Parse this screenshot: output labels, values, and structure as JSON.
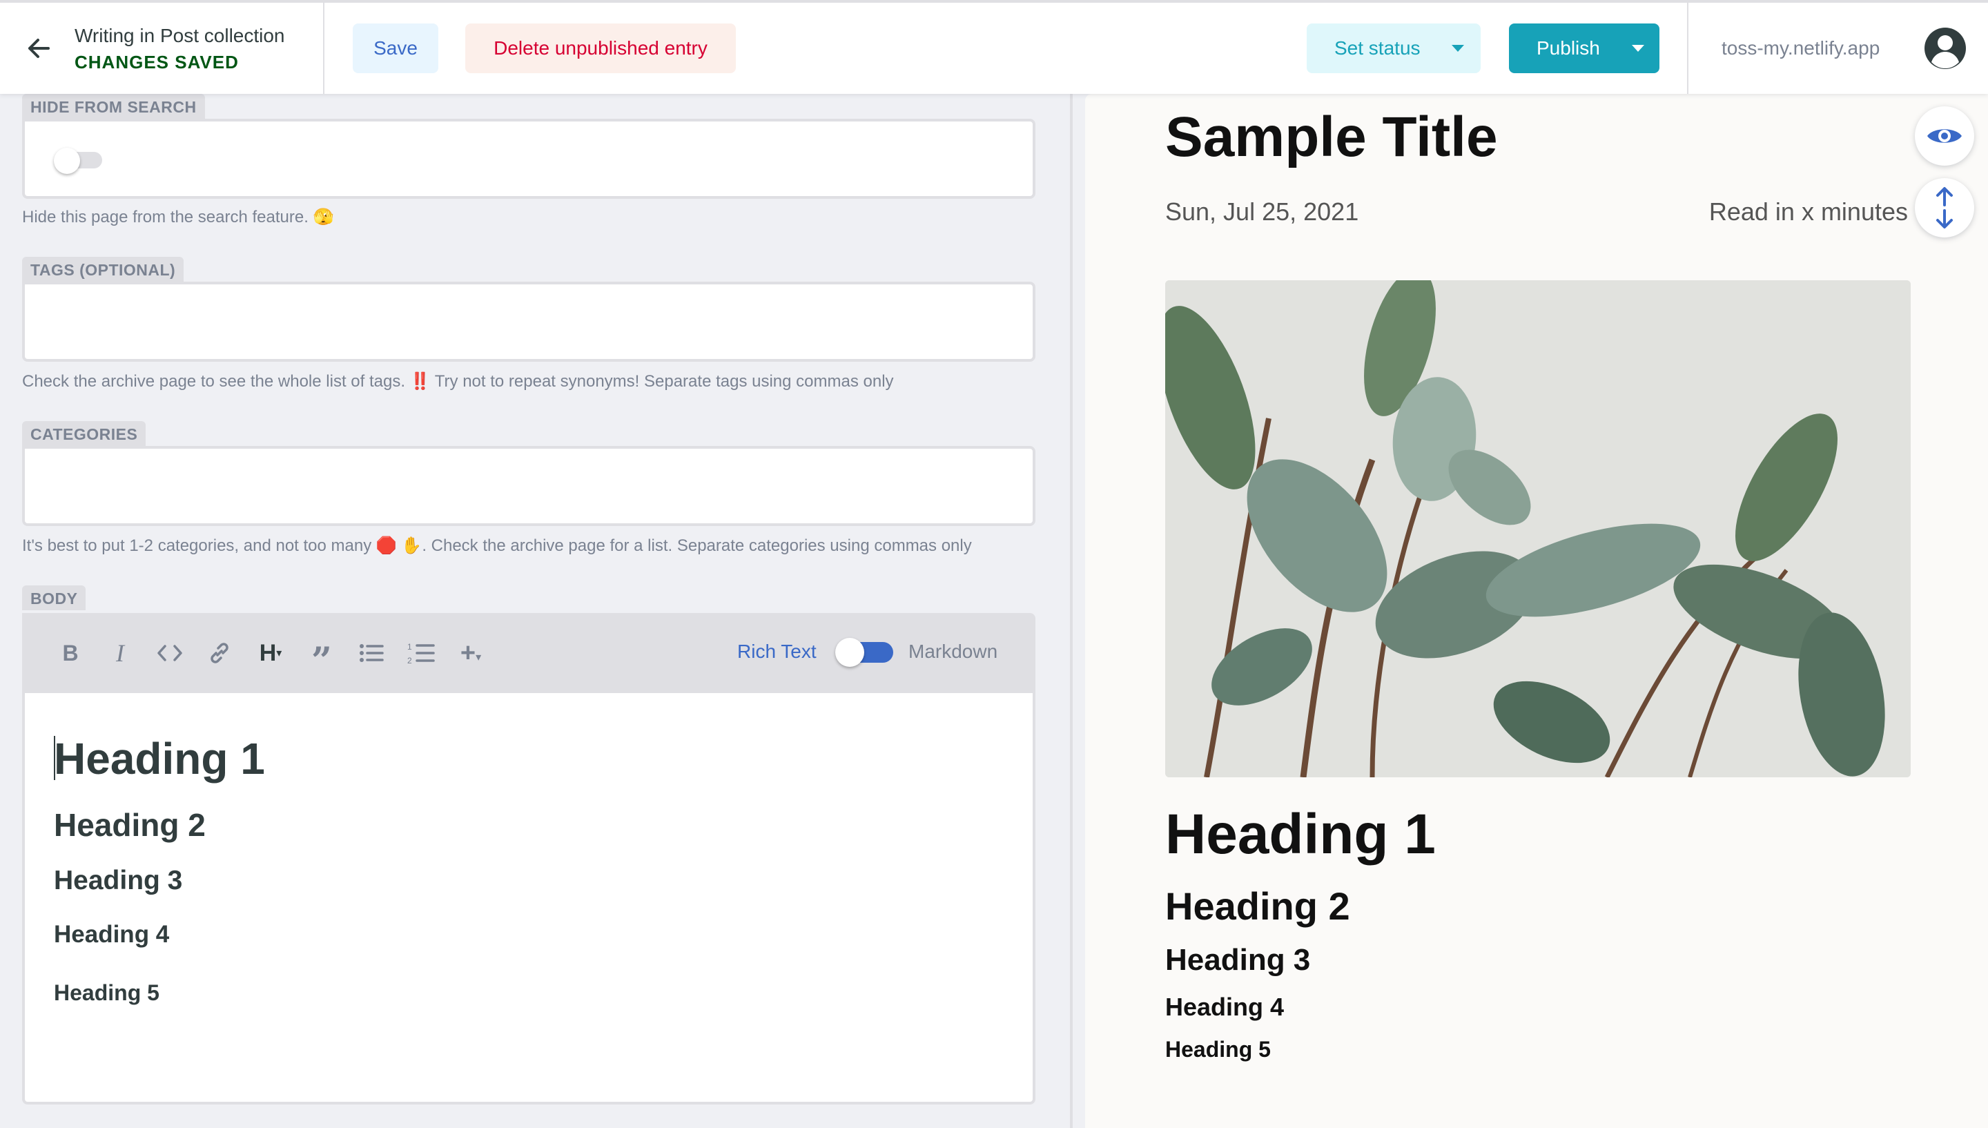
{
  "header": {
    "collection_title": "Writing in Post collection",
    "status": "CHANGES SAVED",
    "save_label": "Save",
    "delete_label": "Delete unpublished entry",
    "set_status_label": "Set status",
    "publish_label": "Publish",
    "site_url": "toss-my.netlify.app"
  },
  "fields": {
    "hide_from_search": {
      "label": "HIDE FROM SEARCH",
      "value": false,
      "hint": "Hide this page from the search feature. 🫣"
    },
    "tags": {
      "label": "TAGS (OPTIONAL)",
      "value": "",
      "hint": "Check the archive page to see the whole list of tags. ‼️ Try not to repeat synonyms! Separate tags using commas only"
    },
    "categories": {
      "label": "CATEGORIES",
      "value": "",
      "hint": "It's best to put 1-2 categories, and not too many 🛑 ✋. Check the archive page for a list. Separate categories using commas only"
    },
    "body": {
      "label": "BODY",
      "toolbar_icons": [
        "bold-icon",
        "italic-icon",
        "code-icon",
        "link-icon",
        "heading-icon",
        "quote-icon",
        "bulleted-list-icon",
        "numbered-list-icon",
        "add-component-icon"
      ],
      "rich_text_label": "Rich Text",
      "markdown_label": "Markdown",
      "mode": "Rich Text",
      "headings": [
        "Heading 1",
        "Heading 2",
        "Heading 3",
        "Heading 4",
        "Heading 5"
      ]
    }
  },
  "preview": {
    "title": "Sample Title",
    "date": "Sun, Jul 25, 2021",
    "read_time": "Read in x minutes",
    "headings": [
      "Heading 1",
      "Heading 2",
      "Heading 3",
      "Heading 4",
      "Heading 5"
    ]
  },
  "colors": {
    "accent_blue": "#3a69c7",
    "teal": "#17a2b8",
    "danger": "#d60032",
    "success": "#005614"
  }
}
